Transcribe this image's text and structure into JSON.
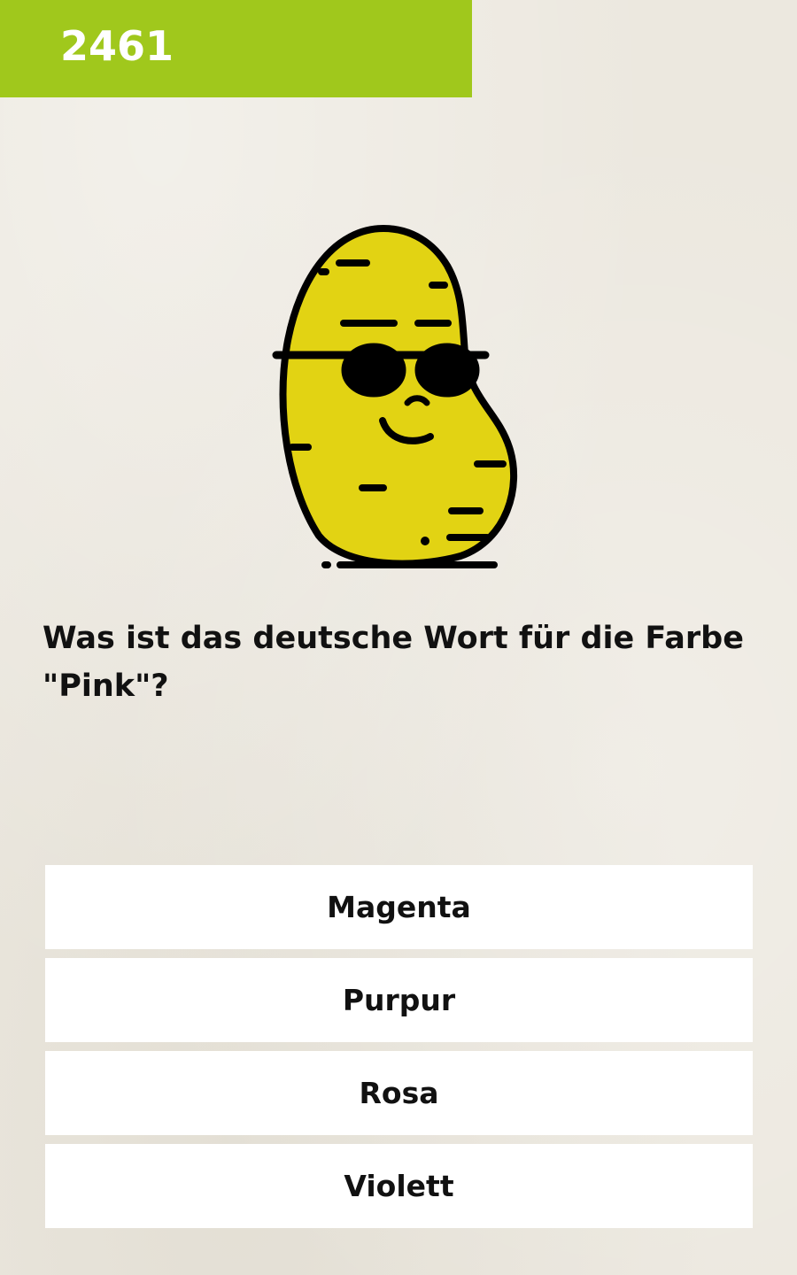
{
  "level": {
    "number": "2461"
  },
  "mascot": {
    "icon": "potato-with-sunglasses-icon"
  },
  "question": {
    "text": "Was ist das deutsche Wort für die Farbe \"Pink\"?"
  },
  "answers": [
    {
      "label": "Magenta"
    },
    {
      "label": "Purpur"
    },
    {
      "label": "Rosa"
    },
    {
      "label": "Violett"
    }
  ],
  "colors": {
    "banner": "#a0c81c",
    "potato_fill": "#e2d313",
    "outline": "#000000",
    "background": "#ece8df",
    "button": "#ffffff"
  }
}
